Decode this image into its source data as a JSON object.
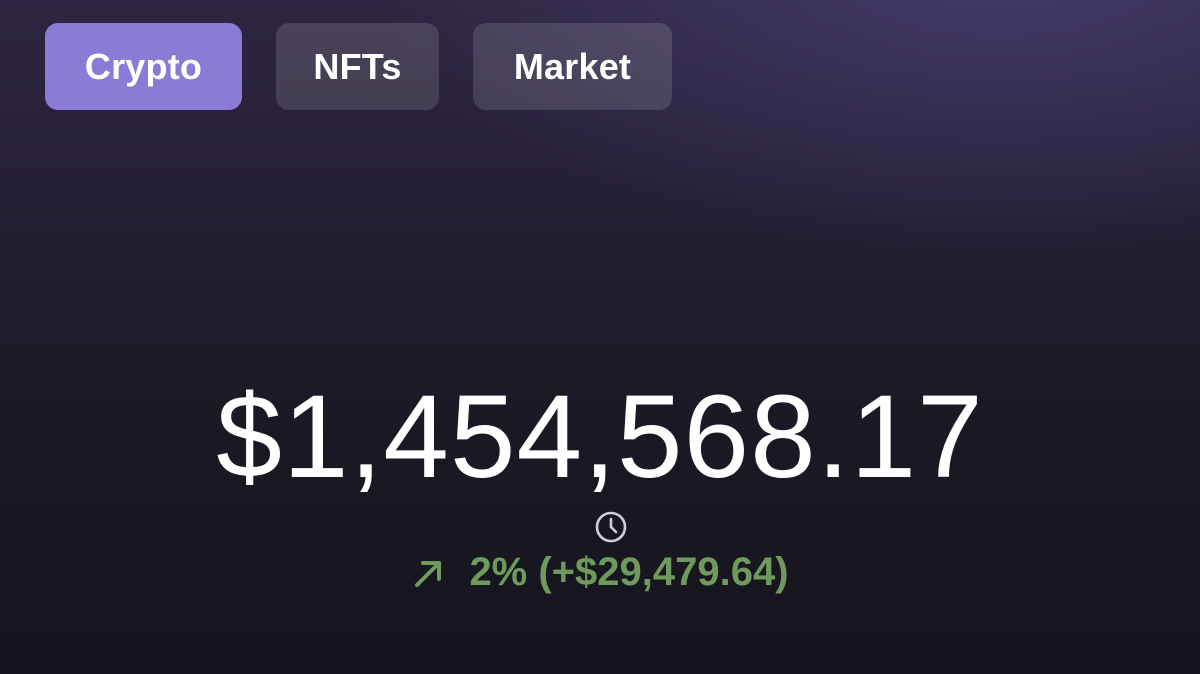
{
  "tabs": [
    {
      "label": "Crypto",
      "active": true
    },
    {
      "label": "NFTs",
      "active": false
    },
    {
      "label": "Market",
      "active": false
    }
  ],
  "balance": {
    "amount": "$1,454,568.17",
    "change_text": "2% (+$29,479.64)",
    "change_direction": "up"
  },
  "icons": {
    "history": "clock-icon",
    "trend": "arrow-up-right-icon"
  },
  "colors": {
    "accent": "#8b7ad6",
    "positive": "#6f9a5e",
    "text": "#ffffff"
  }
}
